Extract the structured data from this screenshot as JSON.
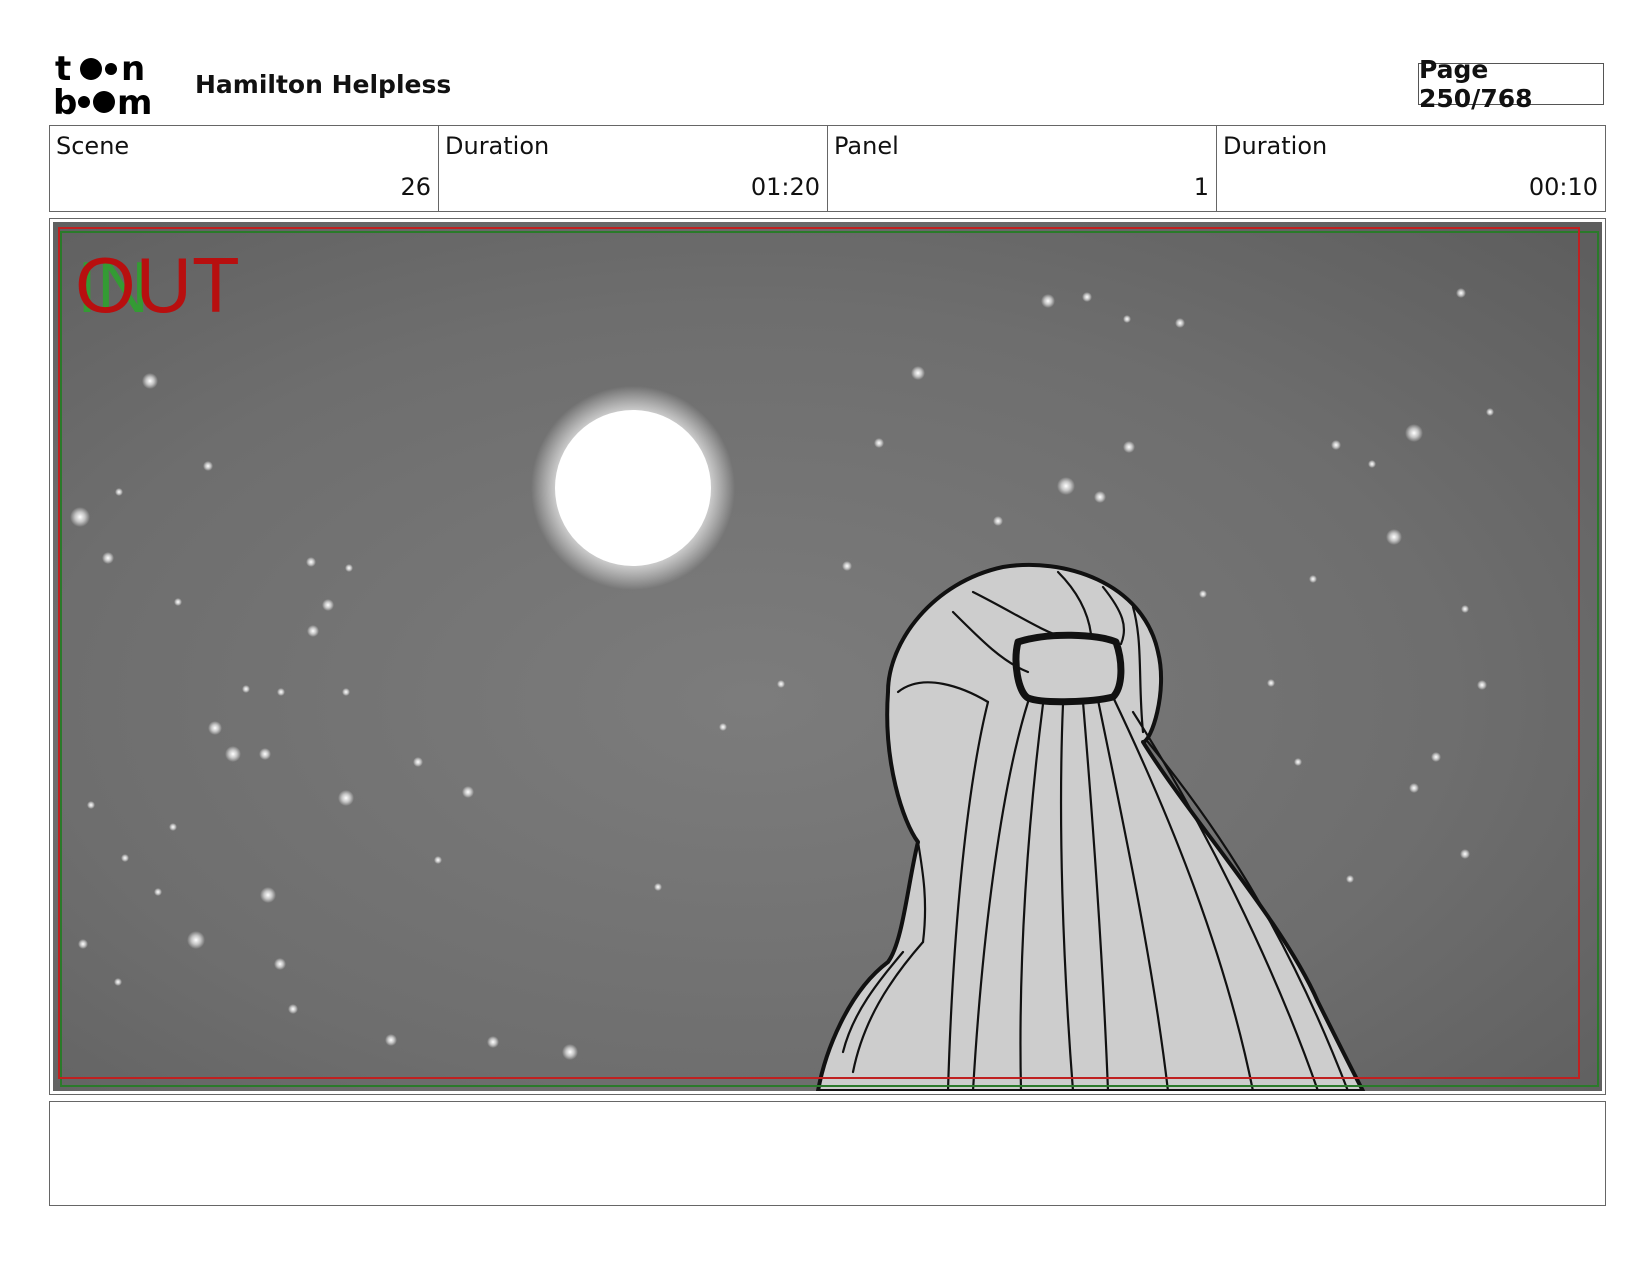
{
  "header": {
    "logo_text": "toon boom",
    "project_title": "Hamilton Helpless",
    "page_label": "Page 250/768"
  },
  "info": {
    "scene_label": "Scene",
    "scene_value": "26",
    "scene_duration_label": "Duration",
    "scene_duration_value": "01:20",
    "panel_label": "Panel",
    "panel_value": "1",
    "panel_duration_label": "Duration",
    "panel_duration_value": "00:10"
  },
  "panel": {
    "transition_out": "OUT",
    "transition_in": "IN",
    "colors": {
      "out_red": "#b80f0f",
      "in_green": "#2fa12f",
      "safe_frame_red": "#c02020",
      "safe_frame_green": "#2a7a2a",
      "sky": "#6e6e6e",
      "hair": "#cdcdcd"
    }
  },
  "notes": {
    "text": ""
  }
}
